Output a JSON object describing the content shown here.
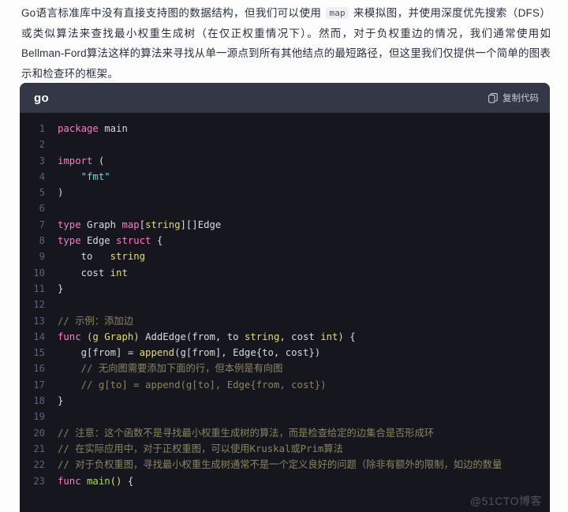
{
  "intro": {
    "part1": "Go语言标准库中没有直接支持图的数据结构，但我们可以使用 ",
    "inline_code": "map",
    "part2": " 来模拟图，并使用深度优先搜索（DFS）或类似算法来查找最小权重生成树（在仅正权重情况下）。然而，对于负权重边的情况，我们通常使用如Bellman-Ford算法这样的算法来寻找从单一源点到所有其他结点的最短路径，但这里我们仅提供一个简单的图表示和检查环的框架。"
  },
  "code_block": {
    "language": "go",
    "copy_label": "复制代码",
    "copy_icon": "copy-icon",
    "colors": {
      "header_bg": "#343746",
      "body_bg": "#16161e",
      "keyword": "#ff79c6",
      "string": "#66d9ef",
      "type": "#e6db74",
      "function": "#a6e22e",
      "comment": "#8a8560",
      "plain": "#d8dae3",
      "line_number": "#5b6279"
    },
    "lines": [
      {
        "n": "1",
        "tokens": [
          {
            "t": "package",
            "c": "t-kw"
          },
          {
            "t": " main",
            "c": "t-pl"
          }
        ]
      },
      {
        "n": "2",
        "tokens": []
      },
      {
        "n": "3",
        "tokens": [
          {
            "t": "import",
            "c": "t-kw"
          },
          {
            "t": " (",
            "c": "t-pl"
          }
        ]
      },
      {
        "n": "4",
        "tokens": [
          {
            "t": "    ",
            "c": "t-pl"
          },
          {
            "t": "\"fmt\"",
            "c": "t-str"
          }
        ]
      },
      {
        "n": "5",
        "tokens": [
          {
            "t": ")",
            "c": "t-pl"
          }
        ]
      },
      {
        "n": "6",
        "tokens": []
      },
      {
        "n": "7",
        "tokens": [
          {
            "t": "type",
            "c": "t-kw"
          },
          {
            "t": " Graph ",
            "c": "t-pl"
          },
          {
            "t": "map",
            "c": "t-kw"
          },
          {
            "t": "[",
            "c": "t-pl"
          },
          {
            "t": "string",
            "c": "t-type"
          },
          {
            "t": "][]Edge",
            "c": "t-pl"
          }
        ]
      },
      {
        "n": "8",
        "tokens": [
          {
            "t": "type",
            "c": "t-kw"
          },
          {
            "t": " Edge ",
            "c": "t-pl"
          },
          {
            "t": "struct",
            "c": "t-kw"
          },
          {
            "t": " {",
            "c": "t-pl"
          }
        ]
      },
      {
        "n": "9",
        "tokens": [
          {
            "t": "    to   ",
            "c": "t-pl"
          },
          {
            "t": "string",
            "c": "t-type"
          }
        ]
      },
      {
        "n": "10",
        "tokens": [
          {
            "t": "    cost ",
            "c": "t-pl"
          },
          {
            "t": "int",
            "c": "t-type"
          }
        ]
      },
      {
        "n": "11",
        "tokens": [
          {
            "t": "}",
            "c": "t-pl"
          }
        ]
      },
      {
        "n": "12",
        "tokens": []
      },
      {
        "n": "13",
        "tokens": [
          {
            "t": "// 示例：添加边",
            "c": "t-cm"
          }
        ]
      },
      {
        "n": "14",
        "tokens": [
          {
            "t": "func",
            "c": "t-kw"
          },
          {
            "t": " ",
            "c": "t-pl"
          },
          {
            "t": "(g Graph)",
            "c": "t-type"
          },
          {
            "t": " AddEdge(from, to ",
            "c": "t-pl"
          },
          {
            "t": "string",
            "c": "t-type"
          },
          {
            "t": ", cost ",
            "c": "t-pl"
          },
          {
            "t": "int",
            "c": "t-type"
          },
          {
            "t": ") {",
            "c": "t-pl"
          }
        ]
      },
      {
        "n": "15",
        "tokens": [
          {
            "t": "    g[from] = ",
            "c": "t-pl"
          },
          {
            "t": "append",
            "c": "t-bi"
          },
          {
            "t": "(g[from], Edge{to, cost})",
            "c": "t-pl"
          }
        ]
      },
      {
        "n": "16",
        "tokens": [
          {
            "t": "    // 无向图需要添加下面的行，但本例是有向图",
            "c": "t-cm"
          }
        ]
      },
      {
        "n": "17",
        "tokens": [
          {
            "t": "    // g[to] = append(g[to], Edge{from, cost})",
            "c": "t-cm"
          }
        ]
      },
      {
        "n": "18",
        "tokens": [
          {
            "t": "}",
            "c": "t-pl"
          }
        ]
      },
      {
        "n": "19",
        "tokens": []
      },
      {
        "n": "20",
        "tokens": [
          {
            "t": "// 注意：这个函数不是寻找最小权重生成树的算法，而是检查给定的边集合是否形成环",
            "c": "t-cm"
          }
        ]
      },
      {
        "n": "21",
        "tokens": [
          {
            "t": "// 在实际应用中，对于正权重图，可以使用Kruskal或Prim算法",
            "c": "t-cm"
          }
        ]
      },
      {
        "n": "22",
        "tokens": [
          {
            "t": "// 对于负权重图，寻找最小权重生成树通常不是一个定义良好的问题（除非有额外的限制，如边的数量",
            "c": "t-cm"
          }
        ]
      },
      {
        "n": "23",
        "tokens": [
          {
            "t": "func",
            "c": "t-kw"
          },
          {
            "t": " ",
            "c": "t-pl"
          },
          {
            "t": "main",
            "c": "t-fn"
          },
          {
            "t": "()",
            "c": "t-pn"
          },
          {
            "t": " {",
            "c": "t-pl"
          }
        ]
      }
    ]
  },
  "watermark": {
    "text": "@51CTO博客"
  }
}
